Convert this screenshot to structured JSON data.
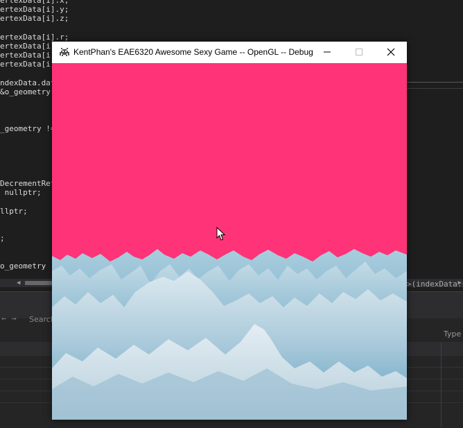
{
  "code": {
    "lines": [
      {
        "text": "ertexData[i].x;"
      },
      {
        "text": "ertexData[i].y;"
      },
      {
        "text": "ertexData[i].z;"
      },
      {
        "text": ""
      },
      {
        "text": "ertexData[i].r;"
      },
      {
        "text": "ertexData[i].g;"
      },
      {
        "text": "ertexData[i].b;"
      },
      {
        "text": "ertexData[i].a;"
      },
      {
        "text": ""
      },
      {
        "text": "ndexData.data"
      },
      {
        "text": "&o_geometry,"
      },
      {
        "text": ""
      },
      {
        "text": ""
      },
      {
        "text": ""
      },
      {
        "text": "_geometry !="
      },
      {
        "text": ""
      },
      {
        "text": ""
      },
      {
        "text": ""
      },
      {
        "text": ""
      },
      {
        "text": ""
      },
      {
        "text": "DecrementRefe"
      },
      {
        "text": " nullptr;"
      },
      {
        "text": ""
      },
      {
        "text": "llptr;"
      },
      {
        "text": ""
      },
      {
        "text": ""
      },
      {
        "text": ";"
      },
      {
        "text": ""
      },
      {
        "text": ""
      },
      {
        "text": "o_geometry"
      }
    ],
    "right_overflow": ">(indexData.s"
  },
  "panel": {
    "nav_icons": "← →",
    "search_label": "Search",
    "type_column": "Type"
  },
  "game_window": {
    "title": "KentPhan's EAE6320 Awesome Sexy Game -- OpenGL -- Debug",
    "buttons": {
      "minimize_icon": "minimize-icon",
      "maximize_icon": "maximize-icon",
      "close_icon": "close-icon"
    },
    "scene": {
      "sky_color": "#ff3377",
      "terrain_light": "#cfe0ea",
      "terrain_mid": "#8cbcd2",
      "terrain_dark": "#3f8bb0"
    }
  }
}
